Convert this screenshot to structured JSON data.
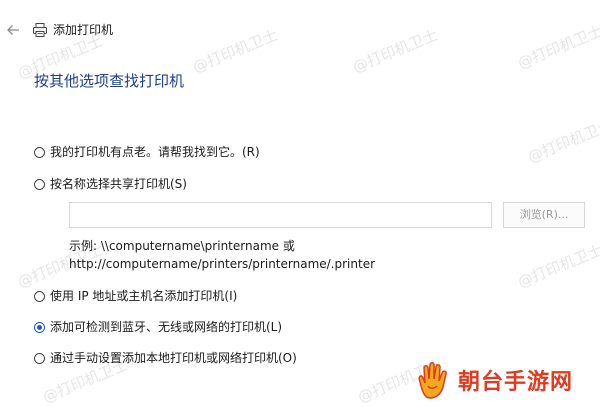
{
  "titlebar": {
    "title": "添加打印机"
  },
  "heading": "按其他选项查找打印机",
  "options": [
    {
      "label": "我的打印机有点老。请帮我找到它。(R)",
      "checked": false
    },
    {
      "label": "按名称选择共享打印机(S)",
      "checked": false
    },
    {
      "label": "使用 IP 地址或主机名添加打印机(I)",
      "checked": false
    },
    {
      "label": "添加可检测到蓝牙、无线或网络的打印机(L)",
      "checked": true
    },
    {
      "label": "通过手动设置添加本地打印机或网络打印机(O)",
      "checked": false
    }
  ],
  "shared": {
    "input_value": "",
    "browse_label": "浏览(R)...",
    "example_line1": "示例: \\\\computername\\printername 或",
    "example_line2": "http://computername/printers/printername/.printer"
  },
  "watermark": "@打印机卫士",
  "logo": {
    "text": "朝台手游网"
  },
  "colors": {
    "heading": "#1c3f94",
    "radio_checked": "#1f57c7",
    "logo": "#e23a1e"
  },
  "icons": {
    "back": "back-arrow-icon",
    "title": "printer-icon",
    "logo": "hand-logo-icon"
  }
}
